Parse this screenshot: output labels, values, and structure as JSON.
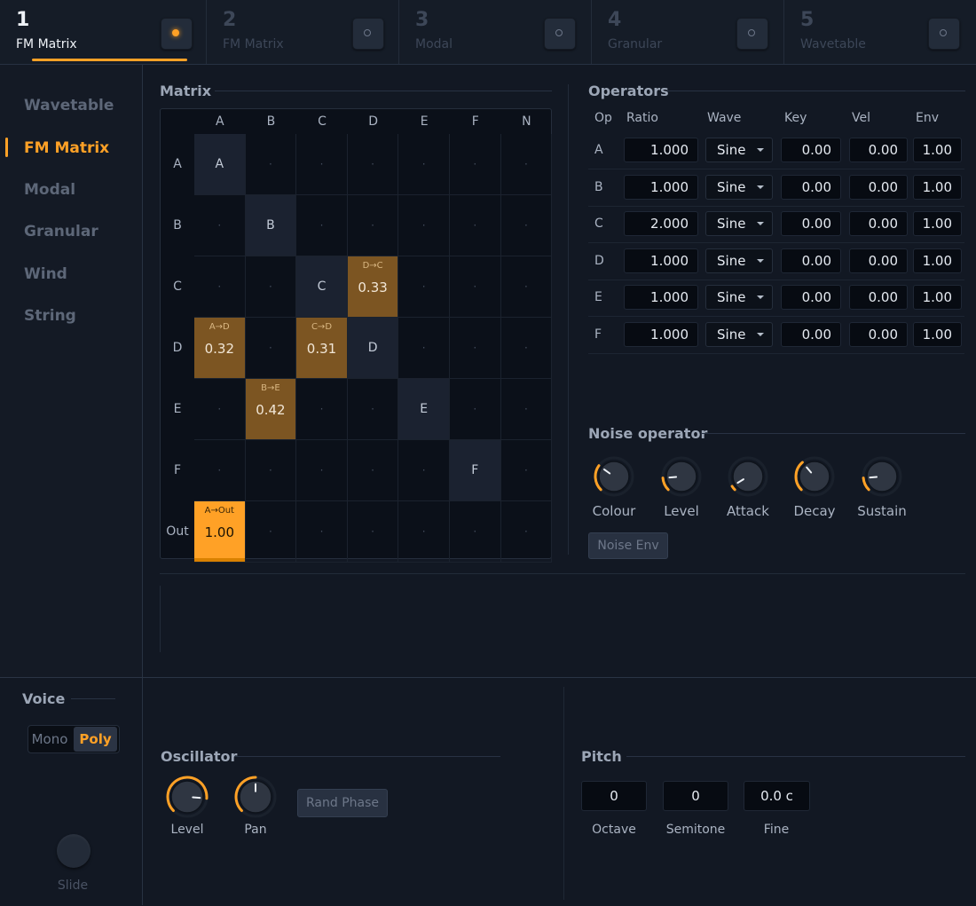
{
  "tabs": [
    {
      "num": "1",
      "name": "FM Matrix",
      "active": true
    },
    {
      "num": "2",
      "name": "FM Matrix",
      "active": false
    },
    {
      "num": "3",
      "name": "Modal",
      "active": false
    },
    {
      "num": "4",
      "name": "Granular",
      "active": false
    },
    {
      "num": "5",
      "name": "Wavetable",
      "active": false
    }
  ],
  "sidebar": {
    "items": [
      "Wavetable",
      "FM Matrix",
      "Modal",
      "Granular",
      "Wind",
      "String"
    ],
    "active_index": 1
  },
  "matrix": {
    "title": "Matrix",
    "columns": [
      "A",
      "B",
      "C",
      "D",
      "E",
      "F",
      "N"
    ],
    "rows": [
      "A",
      "B",
      "C",
      "D",
      "E",
      "F",
      "Out"
    ],
    "empty_symbol": "·",
    "routes": [
      {
        "row": 2,
        "col": 3,
        "label": "D→C",
        "value": "0.33"
      },
      {
        "row": 3,
        "col": 0,
        "label": "A→D",
        "value": "0.32"
      },
      {
        "row": 3,
        "col": 2,
        "label": "C→D",
        "value": "0.31"
      },
      {
        "row": 4,
        "col": 1,
        "label": "B→E",
        "value": "0.42"
      },
      {
        "row": 6,
        "col": 0,
        "label": "A→Out",
        "value": "1.00"
      }
    ]
  },
  "operators": {
    "title": "Operators",
    "headers": {
      "op": "Op",
      "ratio": "Ratio",
      "wave": "Wave",
      "key": "Key",
      "vel": "Vel",
      "env": "Env"
    },
    "rows": [
      {
        "op": "A",
        "ratio": "1.000",
        "wave": "Sine",
        "key": "0.00",
        "vel": "0.00",
        "env": "1.00"
      },
      {
        "op": "B",
        "ratio": "1.000",
        "wave": "Sine",
        "key": "0.00",
        "vel": "0.00",
        "env": "1.00"
      },
      {
        "op": "C",
        "ratio": "2.000",
        "wave": "Sine",
        "key": "0.00",
        "vel": "0.00",
        "env": "1.00"
      },
      {
        "op": "D",
        "ratio": "1.000",
        "wave": "Sine",
        "key": "0.00",
        "vel": "0.00",
        "env": "1.00"
      },
      {
        "op": "E",
        "ratio": "1.000",
        "wave": "Sine",
        "key": "0.00",
        "vel": "0.00",
        "env": "1.00"
      },
      {
        "op": "F",
        "ratio": "1.000",
        "wave": "Sine",
        "key": "0.00",
        "vel": "0.00",
        "env": "1.00"
      }
    ]
  },
  "noise": {
    "title": "Noise operator",
    "knobs": [
      {
        "label": "Colour",
        "level": 0.3
      },
      {
        "label": "Level",
        "level": 0.15
      },
      {
        "label": "Attack",
        "level": 0.05
      },
      {
        "label": "Decay",
        "level": 0.35
      },
      {
        "label": "Sustain",
        "level": 0.15
      }
    ],
    "env_button": "Noise Env"
  },
  "voice": {
    "title": "Voice",
    "modes": [
      "Mono",
      "Poly"
    ],
    "selected": "Poly",
    "slide_label": "Slide"
  },
  "oscillator": {
    "title": "Oscillator",
    "knobs": [
      {
        "label": "Level",
        "level": 0.85
      },
      {
        "label": "Pan",
        "level": 0.5
      }
    ],
    "rand_phase": "Rand Phase"
  },
  "pitch": {
    "title": "Pitch",
    "fields": [
      {
        "label": "Octave",
        "value": "0"
      },
      {
        "label": "Semitone",
        "value": "0"
      },
      {
        "label": "Fine",
        "value": "0.0 c"
      }
    ]
  },
  "colors": {
    "accent": "#ffa126",
    "route": "#7c5522",
    "background": "#121823"
  }
}
